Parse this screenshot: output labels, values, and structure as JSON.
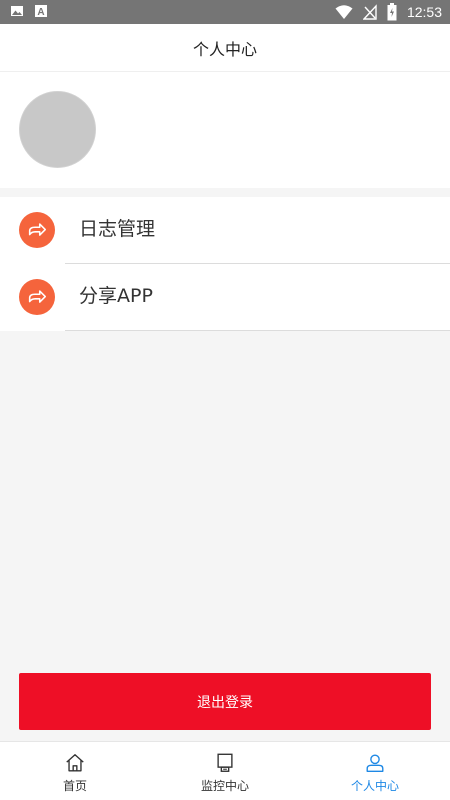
{
  "status_bar": {
    "time": "12:53",
    "icons": [
      "image-icon",
      "a-icon",
      "wifi-icon",
      "no-signal-icon",
      "battery-icon"
    ]
  },
  "header": {
    "title": "个人中心"
  },
  "profile": {
    "avatar": "avatar-placeholder"
  },
  "menu": {
    "items": [
      {
        "label": "日志管理",
        "icon": "share-arrow-icon"
      },
      {
        "label": "分享APP",
        "icon": "share-arrow-icon"
      }
    ]
  },
  "actions": {
    "logout_label": "退出登录"
  },
  "tabbar": {
    "tabs": [
      {
        "label": "首页",
        "icon": "home-icon",
        "active": false
      },
      {
        "label": "监控中心",
        "icon": "monitor-icon",
        "active": false
      },
      {
        "label": "个人中心",
        "icon": "user-icon",
        "active": true
      }
    ]
  },
  "colors": {
    "accent_orange": "#f5643c",
    "logout_red": "#ee0f26",
    "active_tab_blue": "#1e88e5",
    "status_bar_gray": "#757575"
  }
}
